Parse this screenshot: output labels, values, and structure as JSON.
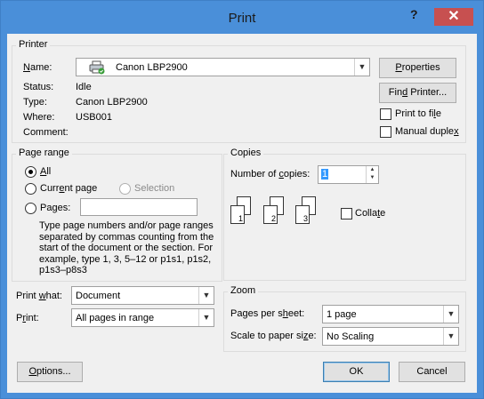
{
  "window": {
    "title": "Print",
    "help_glyph": "?",
    "close_glyph": "✕"
  },
  "printer": {
    "group_label": "Printer",
    "name_label": "Name:",
    "name_value": "Canon LBP2900",
    "status_label": "Status:",
    "status_value": "Idle",
    "type_label": "Type:",
    "type_value": "Canon LBP2900",
    "where_label": "Where:",
    "where_value": "USB001",
    "comment_label": "Comment:",
    "comment_value": "",
    "properties_button": "Properties",
    "find_printer_button": "Find Printer...",
    "print_to_file_label": "Print to file",
    "print_to_file_checked": false,
    "manual_duplex_label": "Manual duplex",
    "manual_duplex_checked": false
  },
  "page_range": {
    "group_label": "Page range",
    "options": {
      "all": "All",
      "current": "Current page",
      "selection": "Selection",
      "pages": "Pages:"
    },
    "selected": "all",
    "pages_value": "",
    "help_text": "Type page numbers and/or page ranges separated by commas counting from the start of the document or the section. For example, type 1, 3, 5–12 or p1s1, p1s2, p1s3–p8s3"
  },
  "copies": {
    "group_label": "Copies",
    "number_label": "Number of copies:",
    "number_value": "1",
    "collate_label": "Collate",
    "collate_checked": false,
    "collate_pages": [
      "1",
      "2",
      "3"
    ]
  },
  "print_what": {
    "label": "Print what:",
    "value": "Document"
  },
  "print": {
    "label": "Print:",
    "value": "All pages in range"
  },
  "zoom": {
    "group_label": "Zoom",
    "pages_per_sheet_label": "Pages per sheet:",
    "pages_per_sheet_value": "1 page",
    "scale_label": "Scale to paper size:",
    "scale_value": "No Scaling"
  },
  "buttons": {
    "options": "Options...",
    "ok": "OK",
    "cancel": "Cancel"
  },
  "icons": {
    "printer": "printer-icon",
    "dropdown": "chevron-down-icon",
    "spinner": "spinner-icon"
  }
}
